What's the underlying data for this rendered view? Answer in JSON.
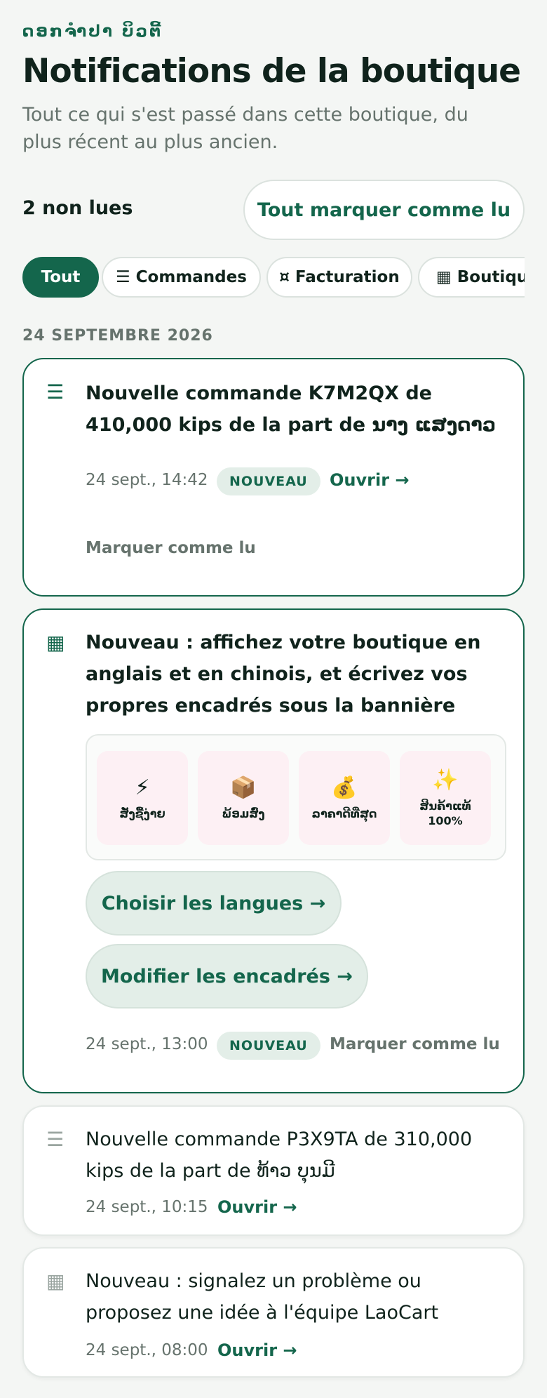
{
  "header": {
    "shop_name": "ດອກຈຳປາ ບິວຕີ້",
    "title": "Notifications de la boutique",
    "subtitle": "Tout ce qui s'est passé dans cette boutique, du plus récent au plus ancien."
  },
  "toolbar": {
    "unread_count": "2 non lues",
    "mark_all_label": "Tout marquer comme lu"
  },
  "filters": [
    {
      "label": "Tout",
      "icon": "",
      "active": true
    },
    {
      "label": "Commandes",
      "icon": "☰",
      "active": false
    },
    {
      "label": "Facturation",
      "icon": "¤",
      "active": false
    },
    {
      "label": "Boutique",
      "icon": "▦",
      "active": false
    }
  ],
  "groups": [
    {
      "date": "24 SEPTEMBRE 2026",
      "notifications": [
        {
          "icon": "list-icon",
          "icon_glyph": "☰",
          "title": "Nouvelle commande K7M2QX de 410,000 kips de la part de ນາງ ແສງດາວ",
          "time": "24 sept., 14:42",
          "badge": "NOUVEAU",
          "open_label": "Ouvrir →",
          "mark_read_label": "Marquer comme lu",
          "unread": true
        },
        {
          "icon": "grid-icon",
          "icon_glyph": "▦",
          "title": "Nouveau : affichez votre boutique en anglais et en chinois, et écrivez vos propres encadrés sous la bannière",
          "features": [
            {
              "icon": "⚡",
              "label": "ສັ່ງຊື້ງ່າຍ"
            },
            {
              "icon": "📦",
              "label": "ພ້ອມສົ່ງ"
            },
            {
              "icon": "💰",
              "label": "ລາຄາດີທີ່ສຸດ"
            },
            {
              "icon": "✨",
              "label": "ສິນຄ້າແທ້ 100%"
            }
          ],
          "actions": [
            "Choisir les langues →",
            "Modifier les encadrés →"
          ],
          "time": "24 sept., 13:00",
          "badge": "NOUVEAU",
          "mark_read_label": "Marquer comme lu",
          "unread": true
        },
        {
          "icon": "list-icon",
          "icon_glyph": "☰",
          "title": "Nouvelle commande P3X9TA de 310,000 kips de la part de ທ້າວ ບຸນມີ",
          "time": "24 sept., 10:15",
          "open_label": "Ouvrir →",
          "unread": false
        },
        {
          "icon": "grid-icon",
          "icon_glyph": "▦",
          "title": "Nouveau : signalez un problème ou proposez une idée à l'équipe LaoCart",
          "time": "24 sept., 08:00",
          "open_label": "Ouvrir →",
          "unread": false
        }
      ]
    }
  ],
  "colors": {
    "accent": "#14664c",
    "background": "#f4f6f4",
    "muted_text": "#66736d",
    "badge_bg": "#e3eee8"
  }
}
